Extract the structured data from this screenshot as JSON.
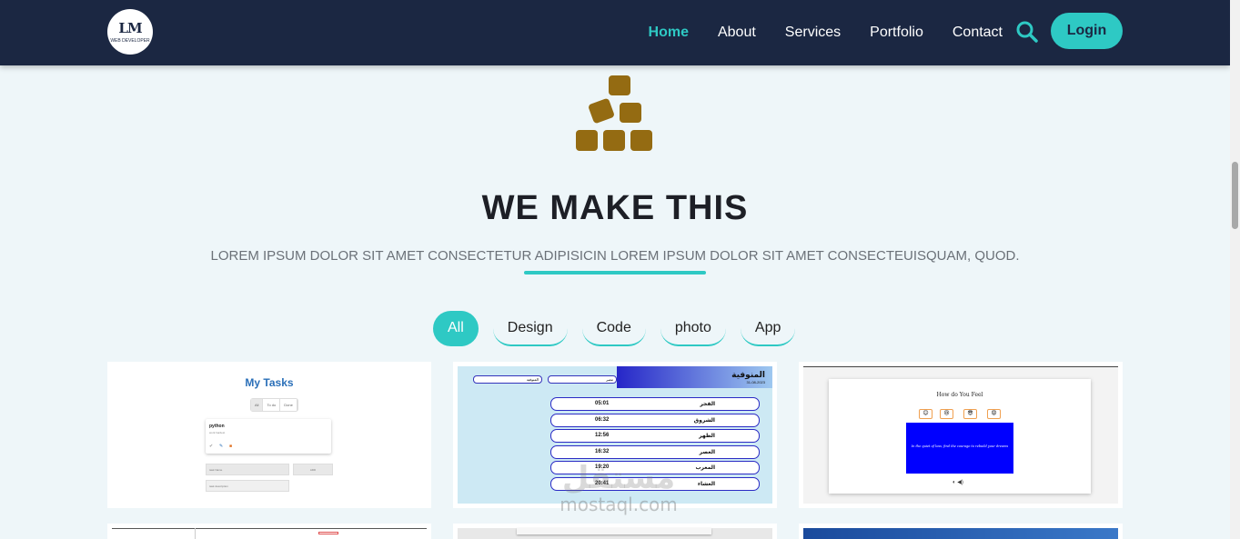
{
  "nav": {
    "logo_text": "LM",
    "logo_sub": "WEB DEVELOPER",
    "links": [
      "Home",
      "About",
      "Services",
      "Portfolio",
      "Contact"
    ],
    "login": "Login"
  },
  "hero": {
    "title": "WE MAKE THIS",
    "subtitle": "LOREM IPSUM DOLOR SIT AMET CONSECTETUR ADIPISICIN LOREM IPSUM DOLOR SIT AMET CONSECTEUISQUAM, QUOD."
  },
  "filters": [
    "All",
    "Design",
    "Code",
    "photo",
    "App"
  ],
  "tasks_card": {
    "title": "My Tasks",
    "tabs": [
      "All",
      "To do",
      "Done"
    ],
    "task_name": "python",
    "task_sub": "work hardest",
    "input1": "task Name",
    "button": "ADD",
    "input2": "task description"
  },
  "prayer_card": {
    "city": "المنوفية",
    "date": "31-08-2023",
    "select1": "المنوفية",
    "select2": "مصر",
    "rows": [
      {
        "name": "الفجر",
        "time": "05:01"
      },
      {
        "name": "الشروق",
        "time": "06:32"
      },
      {
        "name": "الظهر",
        "time": "12:56"
      },
      {
        "name": "العصر",
        "time": "16:32"
      },
      {
        "name": "المغرب",
        "time": "19:20"
      },
      {
        "name": "العشاء",
        "time": "20:41"
      }
    ]
  },
  "feel_card": {
    "title": "How do You Feel",
    "emojis": [
      "😊",
      "😢",
      "😎",
      "😡"
    ],
    "quote": "In the quiet of loss, find the courage to rebuild your dreams",
    "controls": "◐ ◀)"
  },
  "watermark": {
    "arabic": "مستقل",
    "latin": "mostaql.com"
  },
  "colors": {
    "navbar": "#1b2742",
    "accent": "#2ec9c4",
    "hero_icon": "#946b12",
    "background": "#eef6f9"
  }
}
